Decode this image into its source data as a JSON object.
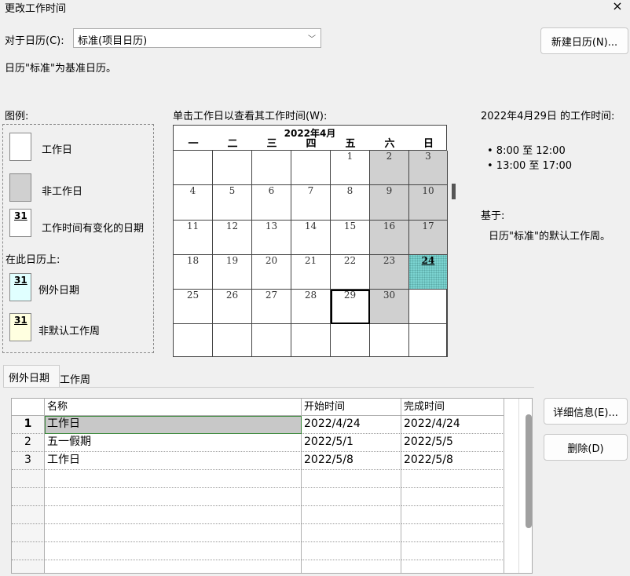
{
  "window": {
    "title": "更改工作时间",
    "close_glyph": "×"
  },
  "calendar_select": {
    "label": "对于日历(C):",
    "value": "标准(项目日历)",
    "chevron": "﹀"
  },
  "new_calendar_button": "新建日历(N)...",
  "base_note": "日历\"标准\"为基准日历。",
  "legend": {
    "title": "图例:",
    "items": [
      {
        "label": "工作日",
        "kind": "working"
      },
      {
        "label": "非工作日",
        "kind": "nonworking"
      },
      {
        "label": "工作时间有变化的日期",
        "kind": "changed",
        "num": "31"
      }
    ],
    "on_this_calendar": "在此日历上:",
    "calendar_items": [
      {
        "label": "例外日期",
        "kind": "exception",
        "num": "31"
      },
      {
        "label": "非默认工作周",
        "kind": "nondefault",
        "num": "31"
      }
    ]
  },
  "calendar_prompt": "单击工作日以查看其工作时间(W):",
  "month_calendar": {
    "month": "2022年4月",
    "weekdays": [
      "一",
      "二",
      "三",
      "四",
      "五",
      "六",
      "日"
    ],
    "weeks": [
      [
        "",
        "",
        "",
        "",
        "1",
        "2",
        "3"
      ],
      [
        "4",
        "5",
        "6",
        "7",
        "8",
        "9",
        "10"
      ],
      [
        "11",
        "12",
        "13",
        "14",
        "15",
        "16",
        "17"
      ],
      [
        "18",
        "19",
        "20",
        "21",
        "22",
        "23",
        "24"
      ],
      [
        "25",
        "26",
        "27",
        "28",
        "29",
        "30",
        ""
      ],
      [
        "",
        "",
        "",
        "",
        "",
        "",
        ""
      ]
    ],
    "selected_day": "29",
    "exception_day": "24"
  },
  "work_times": {
    "heading": "2022年4月29日 的工作时间:",
    "times": [
      "• 8:00 至 12:00",
      "• 13:00 至 17:00"
    ],
    "based_on": "基于:",
    "based_on_text": "日历\"标准\"的默认工作周。"
  },
  "tabs": [
    "例外日期",
    "工作周"
  ],
  "exceptions_table": {
    "columns": [
      "",
      "名称",
      "开始时间",
      "完成时间"
    ],
    "rows": [
      {
        "num": "1",
        "name": "工作日",
        "start": "2022/4/24",
        "end": "2022/4/24"
      },
      {
        "num": "2",
        "name": "五一假期",
        "start": "2022/5/1",
        "end": "2022/5/5"
      },
      {
        "num": "3",
        "name": "工作日",
        "start": "2022/5/8",
        "end": "2022/5/8"
      }
    ],
    "empty_rows": 6
  },
  "details_button": "详细信息(E)...",
  "delete_button": "删除(D)"
}
